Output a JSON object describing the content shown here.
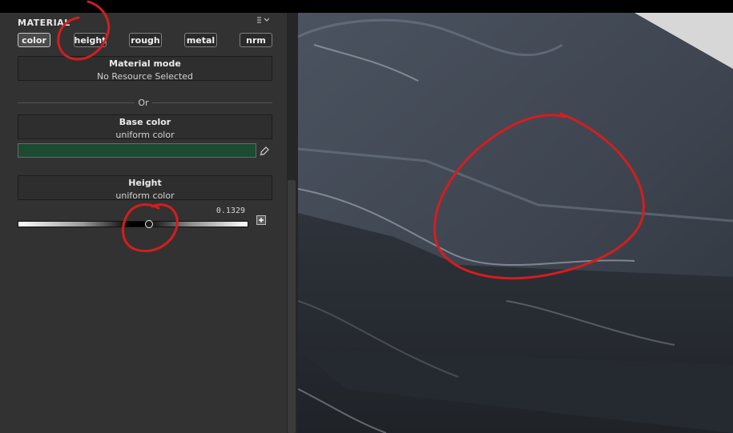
{
  "panel": {
    "section_title": "MATERIAL",
    "section_menu_icon": "sort-icon",
    "tabs": [
      {
        "label": "color",
        "active": true
      },
      {
        "label": "height",
        "active": false
      },
      {
        "label": "rough",
        "active": false
      },
      {
        "label": "metal",
        "active": false
      },
      {
        "label": "nrm",
        "active": false
      }
    ],
    "material_mode": {
      "label": "Material mode",
      "value": "No Resource Selected"
    },
    "or_label": "Or",
    "base_color": {
      "label": "Base color",
      "value": "uniform color",
      "swatch": "#1c4a32",
      "picker_icon": "eyedropper-icon"
    },
    "height": {
      "label": "Height",
      "value": "uniform color",
      "slider_value": "0.1329",
      "slider_fraction": 0.57,
      "reset_icon": "reset-icon"
    }
  },
  "viewport": {
    "content": "3d-rock-preview"
  },
  "colors": {
    "annotation": "#d61d1d",
    "panel_bg": "#323232",
    "viewport_bg": "#3a4147"
  }
}
